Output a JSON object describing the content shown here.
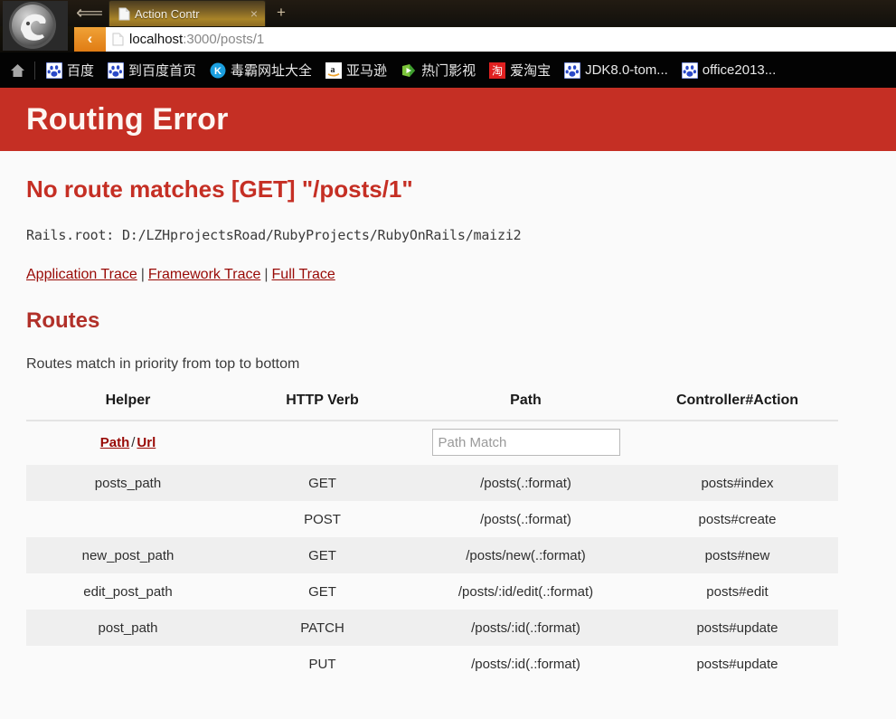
{
  "browser": {
    "logo_icon": "cheetah-browser-logo",
    "back_arrow_icon": "back-arrow-icon",
    "tab": {
      "title": "Action Contr",
      "favicon_icon": "page-favicon",
      "close_icon": "close-icon",
      "close_glyph": "×"
    },
    "new_tab_glyph": "+",
    "address": {
      "back_glyph": "‹",
      "host": "localhost",
      "rest": ":3000/posts/1",
      "favicon_icon": "page-favicon"
    },
    "bookmarks": {
      "home_icon": "home-icon",
      "items": [
        {
          "label": "百度",
          "icon": "baidu-paw-icon"
        },
        {
          "label": "到百度首页",
          "icon": "baidu-paw-icon"
        },
        {
          "label": "毒霸网址大全",
          "icon": "kingsoft-k-icon"
        },
        {
          "label": "亚马逊",
          "icon": "amazon-icon"
        },
        {
          "label": "热门影视",
          "icon": "video-play-icon"
        },
        {
          "label": "爱淘宝",
          "icon": "taobao-icon"
        },
        {
          "label": "JDK8.0-tom...",
          "icon": "baidu-paw-icon"
        },
        {
          "label": "office2013...",
          "icon": "baidu-paw-icon"
        }
      ]
    }
  },
  "page": {
    "banner_title": "Routing Error",
    "error_title": "No route matches [GET] \"/posts/1\"",
    "rails_root": "Rails.root: D:/LZHprojectsRoad/RubyProjects/RubyOnRails/maizi2",
    "trace": {
      "application": "Application Trace",
      "framework": "Framework Trace",
      "full": "Full Trace",
      "separator": "|"
    },
    "routes_heading": "Routes",
    "routes_subtitle": "Routes match in priority from top to bottom",
    "table": {
      "headers": [
        "Helper",
        "HTTP Verb",
        "Path",
        "Controller#Action"
      ],
      "helper_toggle": {
        "path_label": "Path",
        "slash": "/",
        "url_label": "Url"
      },
      "search_placeholder": "Path Match",
      "search_value": "",
      "rows": [
        {
          "helper": "posts_path",
          "verb": "GET",
          "path": "/posts(.:format)",
          "action": "posts#index"
        },
        {
          "helper": "",
          "verb": "POST",
          "path": "/posts(.:format)",
          "action": "posts#create"
        },
        {
          "helper": "new_post_path",
          "verb": "GET",
          "path": "/posts/new(.:format)",
          "action": "posts#new"
        },
        {
          "helper": "edit_post_path",
          "verb": "GET",
          "path": "/posts/:id/edit(.:format)",
          "action": "posts#edit"
        },
        {
          "helper": "post_path",
          "verb": "PATCH",
          "path": "/posts/:id(.:format)",
          "action": "posts#update"
        },
        {
          "helper": "",
          "verb": "PUT",
          "path": "/posts/:id(.:format)",
          "action": "posts#update"
        }
      ]
    }
  },
  "colors": {
    "banner_red": "#c52f24",
    "heading_red": "#b13029",
    "link_red": "#980905",
    "tab_gold": "#a98428",
    "addr_orange": "#e07c14",
    "row_stripe": "#efefef",
    "page_bg": "#fafafa"
  }
}
